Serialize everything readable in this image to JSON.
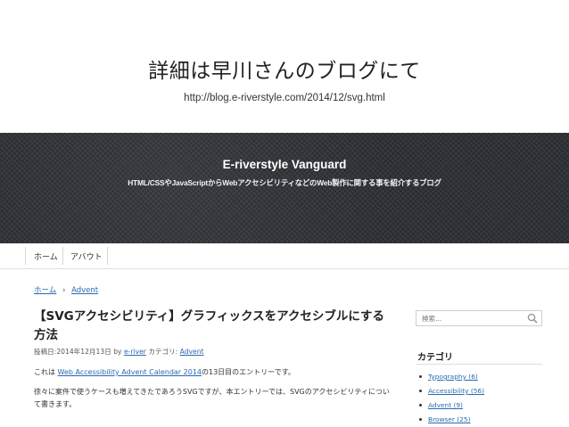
{
  "slide": {
    "title": "詳細は早川さんのブログにて",
    "url": "http://blog.e-riverstyle.com/2014/12/svg.html"
  },
  "site": {
    "title": "E-riverstyle Vanguard",
    "description": "HTML/CSSやJavaScriptからWebアクセシビリティなどのWeb製作に関する事を紹介するブログ"
  },
  "nav": {
    "home": "ホーム",
    "about": "アバウト"
  },
  "breadcrumb": {
    "home": "ホーム",
    "separator": "›",
    "category": "Advent"
  },
  "post": {
    "title": "【SVGアクセシビリティ】グラフィックスをアクセシブルにする方法",
    "meta": {
      "posted_prefix": "投稿日:",
      "date": "2014年12月13日",
      "by": "by",
      "author": "e-river",
      "category_label": "カテゴリ:",
      "category": "Advent"
    },
    "para1": {
      "prefix": "これは",
      "link": "Web Accessibility Advent Calendar 2014",
      "suffix": "の13日目のエントリーです。"
    },
    "para2": "徐々に案件で使うケースも増えてきたであろうSVGですが、本エントリーでは、SVGのアクセシビリティについて書きます。"
  },
  "sidebar": {
    "search_placeholder": "検索...",
    "widget_title": "カテゴリ",
    "categories": [
      {
        "label": "Typography (6)"
      },
      {
        "label": "Accessibility (56)"
      },
      {
        "label": "Advent (9)"
      },
      {
        "label": "Browser (25)"
      }
    ]
  }
}
